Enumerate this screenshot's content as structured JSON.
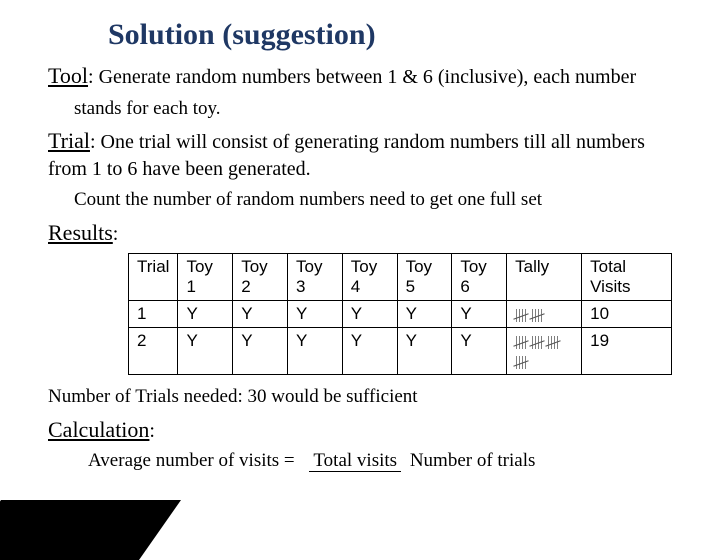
{
  "title": "Solution (suggestion)",
  "tool": {
    "label": "Tool",
    "text": ": Generate random numbers between 1 & 6 (inclusive), each number",
    "cont": "stands for each toy."
  },
  "trial": {
    "label": "Trial",
    "text": ": One trial will consist of generating random numbers till all numbers from 1 to 6 have been generated.",
    "cont": "Count the number of random numbers need to get one full set"
  },
  "results": {
    "label": "Results",
    "colon": ":",
    "headers": [
      "Trial",
      "Toy 1",
      "Toy 2",
      "Toy 3",
      "Toy 4",
      "Toy 5",
      "Toy 6",
      "Tally",
      "Total Visits"
    ],
    "rows": [
      {
        "trial": "1",
        "t1": "Y",
        "t2": "Y",
        "t3": "Y",
        "t4": "Y",
        "t5": "Y",
        "t6": "Y",
        "tally_groups": 2,
        "total": "10"
      },
      {
        "trial": "2",
        "t1": "Y",
        "t2": "Y",
        "t3": "Y",
        "t4": "Y",
        "t5": "Y",
        "t6": "Y",
        "tally_groups": 4,
        "total": "19"
      }
    ]
  },
  "trials_needed": "Number of Trials needed:  30 would be sufficient",
  "calculation": {
    "label": "Calculation",
    "colon": ":",
    "lhs": "Average number of visits =",
    "frac_top": "Total visits",
    "frac_bot": "Number of trials"
  }
}
